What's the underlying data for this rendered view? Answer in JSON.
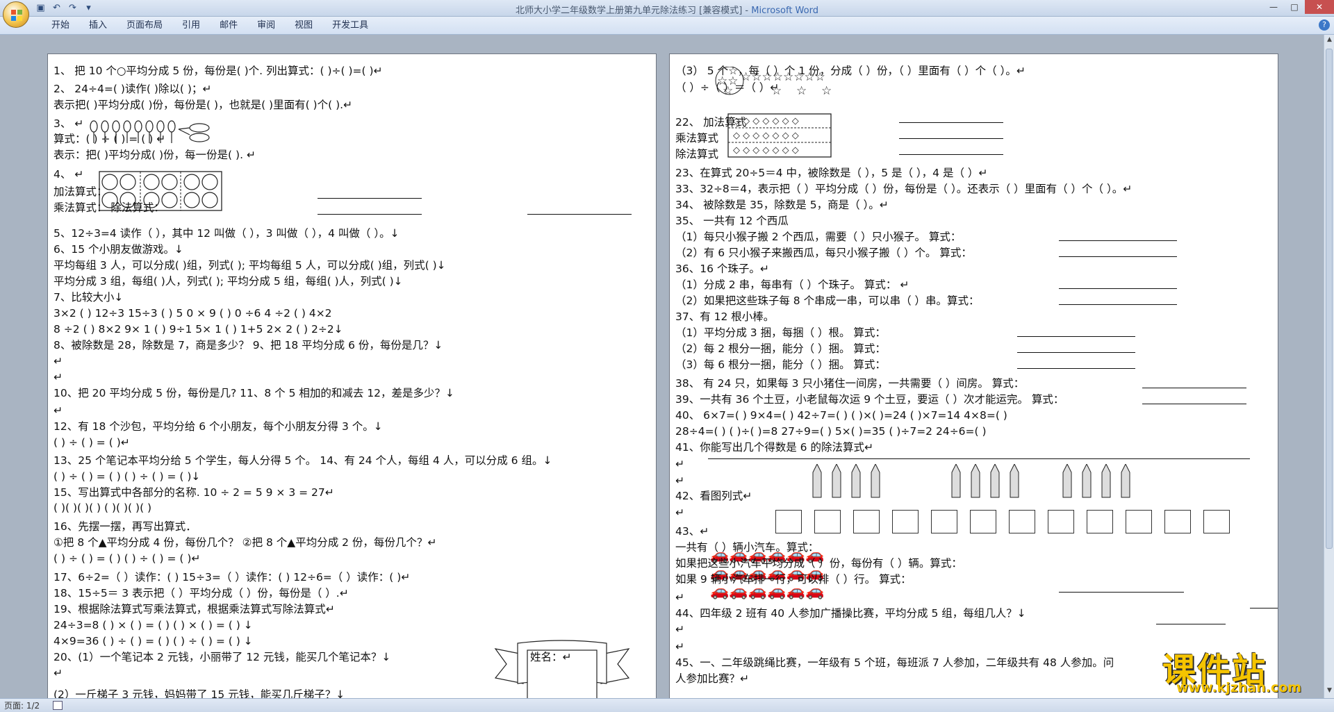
{
  "window": {
    "title_main": "北师大小学二年级数学上册第九单元除法练习 [兼容模式] - ",
    "title_app": "Microsoft Word",
    "controls": [
      "—",
      "□",
      "✕"
    ]
  },
  "quick_access": [
    "save-icon",
    "undo-icon",
    "redo-icon",
    "customize-icon"
  ],
  "ribbon_tabs": [
    "开始",
    "插入",
    "页面布局",
    "引用",
    "邮件",
    "审阅",
    "视图",
    "开发工具"
  ],
  "status": {
    "page": "页面: 1/2"
  },
  "watermark": {
    "text": "课件站",
    "url": "www.kjzhan.com"
  },
  "page1": [
    "1、 把 10 个○平均分成 5 份，每份是(          )个.               列出算式：(          )÷(          )=(          )↵",
    "2、 24÷4=(       )读作(       )除以(      )；↵",
    "     表示把(        )平均分成(      )份，每份是(      )，也就是(        )里面有(        )个(        ).↵",
    "3、 ↵",
    "                                                       算式：(      ) ÷ (      ) = (      ) ↵",
    "                                                       表示：把(          )平均分成(          )份，每一份是(          ).  ↵",
    "4、 ↵",
    "                                                       加法算式：",
    "                                                       乘法算式：                                    除法算式：",
    "5、12÷3=4 读作（              ），其中 12 叫做（              ），3 叫做（              ），4 叫做（              ）。↓",
    "6、15 个小朋友做游戏。↓",
    "     平均每组 3 人，可以分成(     )组，列式(              );    平均每组 5 人，可以分成(     )组，列式(              )↓",
    "     平均分成 3 组，每组(          )人，列式(              );    平均分成 5 组，每组(          )人，列式(              )↓",
    "7、比较大小↓",
    "     3×2 (      ) 12÷3           15÷3 (        ) 5               0 × 9 (     ) 0 ÷6              4 ÷2 (      ) 4×2",
    "     8 ÷2 (      ) 8×2         9× 1 (      )  9÷1               5× 1 (      )  1+5             2× 2 (      )  2÷2↓",
    "8、被除数是 28，除数是 7，商是多少？                       9、把 18 平均分成 6 份，每份是几？↓",
    "↵",
    "↵",
    "10、把 20 平均分成 5 份，每份是几?                         11、8 个 5 相加的和减去 12，差是多少？↓",
    "↵",
    "12、有 18 个沙包，平均分给 6 个小朋友，每个小朋友分得 3 个。↓",
    "       (      ) ÷ (      ) = (      )↵",
    "13、25 个笔记本平均分给 5 个学生，每人分得 5 个。     14、有 24 个人，每组 4 人，可以分成 6 组。↓",
    "  (      ) ÷ (      ) = (      )                                                 (      ) ÷ (      ) = (      )↓",
    "15、写出算式中各部分的名称.       10    ÷     2     =       5                 9     ×     3    =       27↵",
    "                                                 (      )(      )(      )(      )       (      )(      )(      )(      )",
    "16、先摆一摆，再写出算式．",
    "     ①把 8 个▲平均分成 4 份，每份几个？       ②把 8 个▲平均分成 2 份，每份几个？↵",
    "        (      ) ÷ (      ) = (      )                        (      ) ÷ (      ) = (      )↵",
    "17、6÷2=（   ）读作：(             )    15÷3=（   ）读作：(             )    12÷6=（   ）读作：(                 )↵",
    "18、15÷5＝ 3 表示把（           ）平均分成（           ）份，每份是（         ）.↵",
    "19、根据除法算式写乘法算式，根据乘法算式写除法算式↵",
    "24÷3=8    (      ) × (      ) = (      )          (      ) × (      ) = (      )    ↓",
    "4×9=36    (      ) ÷ (      ) = (      )          (      ) ÷ (      ) = (      )    ↓",
    "20、(1）一个笔记本 2 元钱，小丽带了 12 元钱，能买几个笔记本？↓",
    "↵",
    "     (2）一斤梯子 3 元钱，妈妈带了 15 元钱，能买几斤梯子？↓"
  ],
  "page1_name_label": "姓名：↵",
  "page2": [
    "（3）                                                      5 个☆，每（     ）个 1 份，分成（     ）份，（     ）里面有（   ）个（     ）。↵",
    "                                                                                       （      ）÷（         ）＝（         ）↵",
    "22、                                                       加法算式",
    "                                                                乘法算式",
    "                                                                除法算式",
    "23、在算式 20÷5＝4 中，被除数是（          ），5 是（          ），4 是（          ）↵",
    "33、32÷8＝4，表示把（       ）平均分成（      ）份，每份是（        ）。还表示（      ）里面有（      ）个（      ）。↵",
    "34、 被除数是 35，除数是 5，商是（       ）。↵",
    "35、 一共有 12 个西瓜",
    "（1）每只小猴子搬 2 个西瓜，需要（      ）只小猴子。        算式：",
    "（2）有 6 只小猴子来搬西瓜，每只小猴子搬（    ）个。        算式：",
    "36、16 个珠子。↵",
    "（1）分成 2 串，每串有（        ）个珠子。                       算式：                                        ↵",
    "（2）如果把这些珠子每 8 个串成一串，可以串（        ）串。算式：",
    "37、有 12 根小棒。",
    "（1）平均分成 3 捆，每捆（      ）根。                  算式：",
    "（2）每 2 根分一捆，能分（      ）捆。                  算式：",
    "（3）每 6 根分一捆，能分（      ）捆。                  算式：",
    "38、 有 24 只，如果每 3 只小猪住一间房，一共需要（        ）间房。        算式：",
    "39、一共有 36 个土豆，小老鼠每次运 9 个土豆，要运（        ）次才能运完。  算式：",
    "40、   6×7=(      )          9×4=(      )          42÷7=(      )         (      )×(      )=24      (      )×7=14      4×8=(      )",
    "       28÷4=(      )       (      )÷(      )=8      27÷9=(      )          5×(      )=35      (      )÷7=2       24÷6=(      )",
    "41、你能写出几个得数是 6 的除法算式↵",
    "↵",
    "↵",
    "42、看图列式↵",
    "↵",
    "43、↵",
    "                                                                     一共有（     ）辆小汽车。算式：",
    "                                                                  如果把这些小汽车平均分成（      ）份，每份有（      ）辆。算式：",
    "                                                                  如果 9 辆小汽车排一行，可以排（      ）行。  算式：",
    "↵",
    "44、四年级 2 班有 40 人参加广播操比赛，平均分成 5 组，每组几人？↓",
    "↵",
    "↵",
    "45、一、二年级跳绳比赛，一年级有 5 个班，每班派 7 人参加，二年级共有 48 人参加。问",
    "人参加比赛？↵"
  ]
}
